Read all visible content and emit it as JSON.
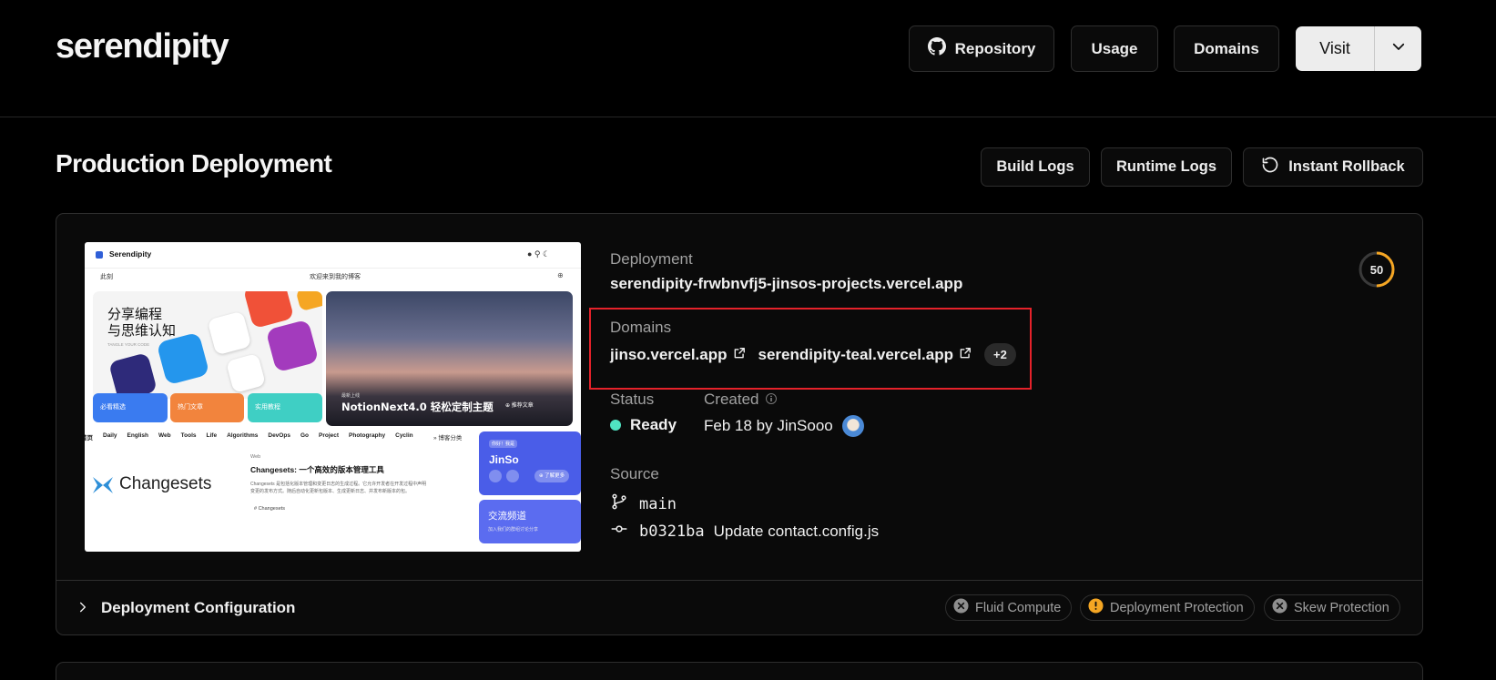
{
  "header": {
    "project_name": "serendipity",
    "repository_label": "Repository",
    "usage_label": "Usage",
    "domains_label": "Domains",
    "visit_label": "Visit"
  },
  "section": {
    "title": "Production Deployment",
    "build_logs_label": "Build Logs",
    "runtime_logs_label": "Runtime Logs",
    "instant_rollback_label": "Instant Rollback"
  },
  "deployment": {
    "label": "Deployment",
    "url": "serendipity-frwbnvfj5-jinsos-projects.vercel.app",
    "score": "50",
    "score_fraction": 0.5,
    "domains_label": "Domains",
    "domains": [
      "jinso.vercel.app",
      "serendipity-teal.vercel.app"
    ],
    "domains_more": "+2",
    "status_label": "Status",
    "status_value": "Ready",
    "created_label": "Created",
    "created_value": "Feb 18 by JinSooo",
    "source_label": "Source",
    "branch": "main",
    "commit_hash": "b0321ba",
    "commit_message": "Update contact.config.js"
  },
  "preview": {
    "site_name": "Serendipity",
    "nav_left": "此刻",
    "nav_center": "欢迎来到我的博客",
    "hero_text_line1": "分享编程",
    "hero_text_line2": "与思维认知",
    "hero_sub": "TANGLE YOUR CODE",
    "hero_image_tag": "最新上线",
    "hero_image_title": "NotionNext4.0 轻松定制主题",
    "hero_image_button": "推荐文章",
    "tiles": [
      "必看精选",
      "热门文章",
      "实用教程"
    ],
    "categories": [
      "首页",
      "Daily",
      "English",
      "Web",
      "Tools",
      "Life",
      "Algorithms",
      "DevOps",
      "Go",
      "Project",
      "Photography",
      "Cyclin"
    ],
    "categories_more": "博客分类",
    "post_category": "Web",
    "post_title": "Changesets: 一个高效的版本管理工具",
    "post_excerpt_1": "Changesets 是包括化版本管理和变更日志的生成过程。它允许开发者在开发过程中声明",
    "post_excerpt_2": "变更的发布方式。随后自动化更新包版本、生成更新日志、并发布新版本的包。",
    "post_tag": "# Changesets",
    "changesets_logo_text": "Changesets",
    "profile_badge": "你好！我是",
    "profile_name": "JinSo",
    "profile_button": "了解更多",
    "community_title": "交流频道",
    "community_sub": "加入我们的群组讨论分享"
  },
  "config": {
    "title": "Deployment Configuration",
    "pills": [
      "Fluid Compute",
      "Deployment Protection",
      "Skew Protection"
    ]
  },
  "colors": {
    "accent_ready": "#50e3c2",
    "score_ring": "#f5a623",
    "highlight_box": "#e5222a",
    "warning": "#f5a623"
  },
  "icons": {
    "repository": "github-icon",
    "visit_dropdown": "chevron-down-icon",
    "rollback": "rotate-ccw-icon",
    "external": "external-link-icon",
    "branch": "git-branch-icon",
    "commit": "git-commit-icon",
    "expand": "chevron-right-icon",
    "pill_disabled": "x-circle-icon",
    "pill_warning": "alert-circle-icon",
    "info": "info-icon"
  }
}
